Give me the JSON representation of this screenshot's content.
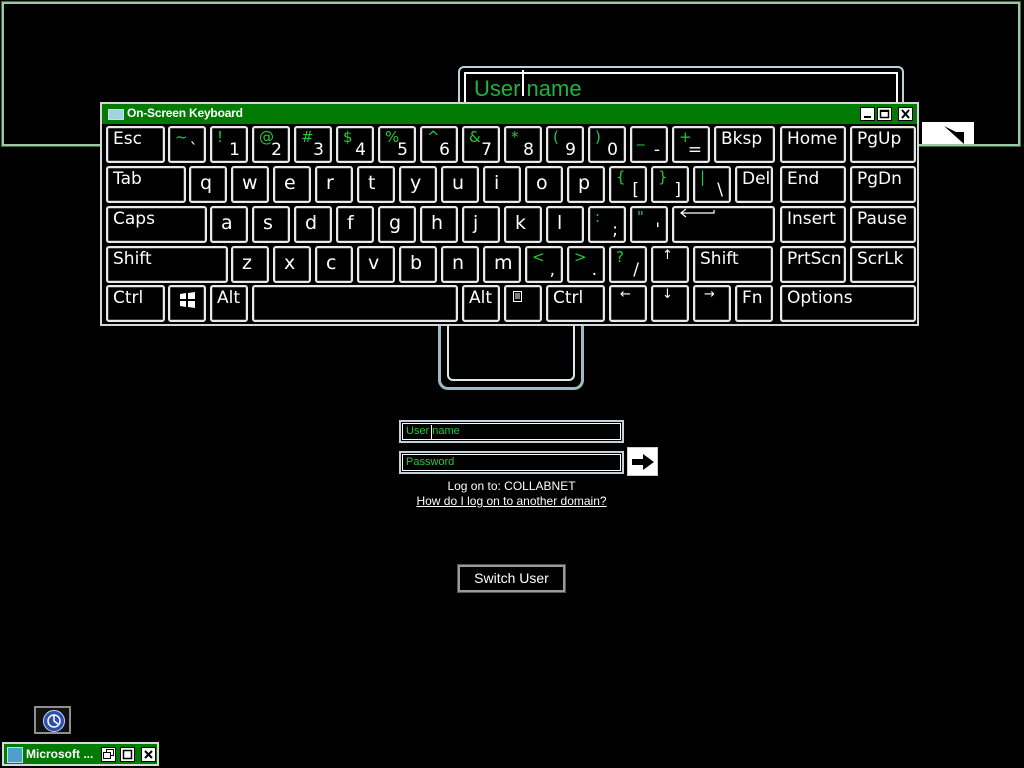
{
  "magnifier": {
    "field_text": "User name"
  },
  "osk": {
    "title": "On-Screen Keyboard",
    "rows": [
      [
        {
          "id": "esc",
          "label": "Esc"
        },
        {
          "id": "backtick",
          "top": "~",
          "bottom": "`"
        },
        {
          "id": "1",
          "top": "!",
          "bottom": "1"
        },
        {
          "id": "2",
          "top": "@",
          "bottom": "2"
        },
        {
          "id": "3",
          "top": "#",
          "bottom": "3"
        },
        {
          "id": "4",
          "top": "$",
          "bottom": "4"
        },
        {
          "id": "5",
          "top": "%",
          "bottom": "5"
        },
        {
          "id": "6",
          "top": "^",
          "bottom": "6"
        },
        {
          "id": "7",
          "top": "&",
          "bottom": "7"
        },
        {
          "id": "8",
          "top": "*",
          "bottom": "8"
        },
        {
          "id": "9",
          "top": "(",
          "bottom": "9"
        },
        {
          "id": "0",
          "top": ")",
          "bottom": "0"
        },
        {
          "id": "minus",
          "top": "_",
          "bottom": "-"
        },
        {
          "id": "equals",
          "top": "+",
          "bottom": "="
        },
        {
          "id": "bksp",
          "label": "Bksp"
        },
        {
          "id": "home",
          "label": "Home"
        },
        {
          "id": "pgup",
          "label": "PgUp"
        }
      ],
      [
        {
          "id": "tab",
          "label": "Tab"
        },
        {
          "id": "q",
          "label": "q"
        },
        {
          "id": "w",
          "label": "w"
        },
        {
          "id": "e",
          "label": "e"
        },
        {
          "id": "r",
          "label": "r"
        },
        {
          "id": "t",
          "label": "t"
        },
        {
          "id": "y",
          "label": "y"
        },
        {
          "id": "u",
          "label": "u"
        },
        {
          "id": "i",
          "label": "i"
        },
        {
          "id": "o",
          "label": "o"
        },
        {
          "id": "p",
          "label": "p"
        },
        {
          "id": "lbracket",
          "top": "{",
          "bottom": "["
        },
        {
          "id": "rbracket",
          "top": "}",
          "bottom": "]"
        },
        {
          "id": "backslash",
          "top": "|",
          "bottom": "\\"
        },
        {
          "id": "del",
          "label": "Del"
        },
        {
          "id": "end",
          "label": "End"
        },
        {
          "id": "pgdn",
          "label": "PgDn"
        }
      ],
      [
        {
          "id": "caps",
          "label": "Caps"
        },
        {
          "id": "a",
          "label": "a"
        },
        {
          "id": "s",
          "label": "s"
        },
        {
          "id": "d",
          "label": "d"
        },
        {
          "id": "f",
          "label": "f"
        },
        {
          "id": "g",
          "label": "g"
        },
        {
          "id": "h",
          "label": "h"
        },
        {
          "id": "j",
          "label": "j"
        },
        {
          "id": "k",
          "label": "k"
        },
        {
          "id": "l",
          "label": "l"
        },
        {
          "id": "semicolon",
          "top": ":",
          "bottom": ";"
        },
        {
          "id": "quote",
          "top": "\"",
          "bottom": "'"
        },
        {
          "id": "enter",
          "label": "⟵"
        },
        {
          "id": "insert",
          "label": "Insert"
        },
        {
          "id": "pause",
          "label": "Pause"
        }
      ],
      [
        {
          "id": "lshift",
          "label": "Shift"
        },
        {
          "id": "z",
          "label": "z"
        },
        {
          "id": "x",
          "label": "x"
        },
        {
          "id": "c",
          "label": "c"
        },
        {
          "id": "v",
          "label": "v"
        },
        {
          "id": "b",
          "label": "b"
        },
        {
          "id": "n",
          "label": "n"
        },
        {
          "id": "m",
          "label": "m"
        },
        {
          "id": "comma",
          "top": "<",
          "bottom": ","
        },
        {
          "id": "period",
          "top": ">",
          "bottom": "."
        },
        {
          "id": "slash",
          "top": "?",
          "bottom": "/"
        },
        {
          "id": "up",
          "label": "↑"
        },
        {
          "id": "rshift",
          "label": "Shift"
        },
        {
          "id": "prtscn",
          "label": "PrtScn"
        },
        {
          "id": "scrlk",
          "label": "ScrLk"
        }
      ],
      [
        {
          "id": "lctrl",
          "label": "Ctrl"
        },
        {
          "id": "win",
          "label": ""
        },
        {
          "id": "lalt",
          "label": "Alt"
        },
        {
          "id": "space",
          "label": ""
        },
        {
          "id": "ralt",
          "label": "Alt"
        },
        {
          "id": "menu",
          "label": ""
        },
        {
          "id": "rctrl",
          "label": "Ctrl"
        },
        {
          "id": "left",
          "label": "←"
        },
        {
          "id": "down",
          "label": "↓"
        },
        {
          "id": "right",
          "label": "→"
        },
        {
          "id": "fn",
          "label": "Fn"
        },
        {
          "id": "options",
          "label": "Options"
        }
      ]
    ]
  },
  "logon": {
    "username_placeholder": "User name",
    "password_placeholder": "Password",
    "logon_to": "Log on to: COLLABNET",
    "domain_link": "How do I log on to another domain?",
    "switch_user": "Switch User"
  },
  "taskbar": {
    "app_label": "Microsoft ..."
  },
  "colors": {
    "accent_green": "#22c93a",
    "title_green": "#007a00"
  }
}
